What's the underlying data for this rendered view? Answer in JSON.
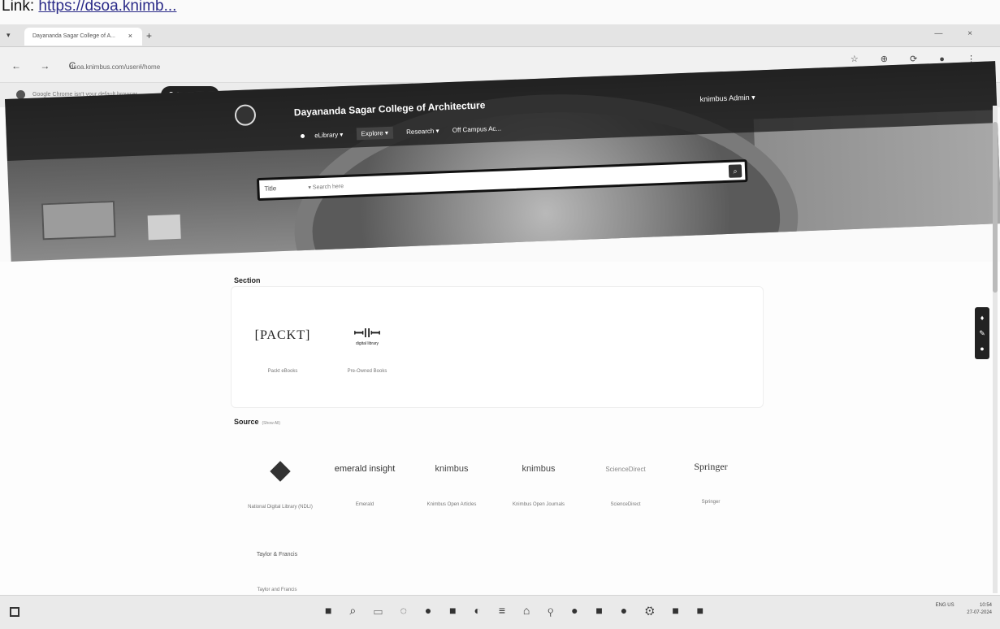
{
  "caption": {
    "prefix": "Link:",
    "url": "https://dsoa.knimb..."
  },
  "browser": {
    "tab_title": "Dayananda Sagar College of A...",
    "tab_close": "×",
    "new_tab": "+",
    "address": "dsoa.knimbus.com/user#/home",
    "nav_icons": "← → C",
    "right_icons": "☆ ⊕ ⟳ ● ⋮",
    "window_controls": "— ×",
    "infobar_message": "Google Chrome isn't your default browser",
    "set_default_label": "Set as default",
    "infobar_close": "×"
  },
  "site": {
    "title": "Dayananda Sagar College of Architecture",
    "user_menu": "knimbus Admin ▾",
    "nav": [
      "eLibrary ▾",
      "Explore ▾",
      "Research ▾",
      "Off Campus Ac..."
    ],
    "search_field": "Title",
    "search_placeholder": "▾ Search here",
    "search_icon": "⌕"
  },
  "section": {
    "title": "Section",
    "tiles": [
      {
        "logo": "[PACKT]",
        "label": "Packt eBooks"
      },
      {
        "logo": "digital library",
        "label": "Pre-Owned Books"
      }
    ]
  },
  "source": {
    "title": "Source",
    "count_label": "(Show All)",
    "tiles": [
      {
        "logo": "NDL",
        "label": "National Digital Library (NDLI)"
      },
      {
        "logo": "emerald insight",
        "label": "Emerald"
      },
      {
        "logo": "knimbus",
        "label": "Knimbus Open Articles"
      },
      {
        "logo": "knimbus",
        "label": "Knimbus Open Journals"
      },
      {
        "logo": "ScienceDirect",
        "label": "ScienceDirect"
      },
      {
        "logo": "Springer",
        "label": "Springer"
      },
      {
        "logo": "Taylor & Francis",
        "label": "Taylor and Francis"
      }
    ]
  },
  "taskbar": {
    "icons": "■ ⌕ ▭ ◌ ● ■ ◐ ≡ ⌂ ⚲ ● ■ ● ⚙ ■ ■",
    "lang": "ENG US",
    "time": "10:54",
    "date": "27-07-2024"
  }
}
